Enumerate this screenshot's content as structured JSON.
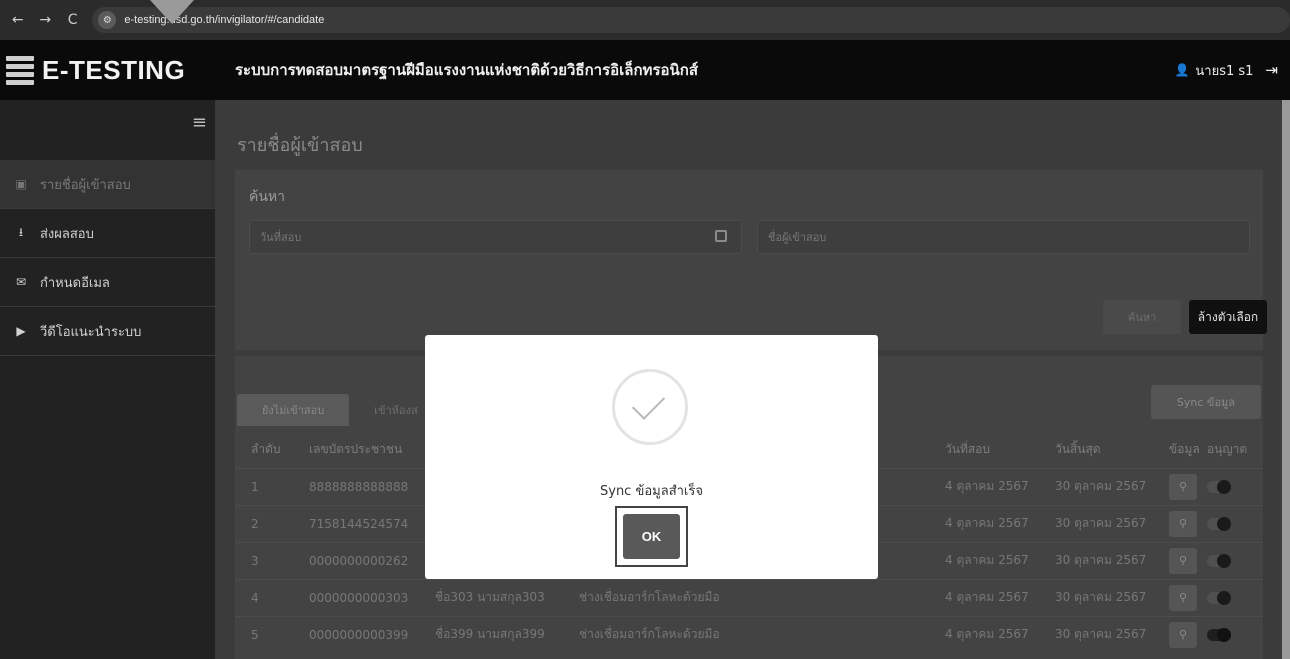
{
  "browser": {
    "back": "←",
    "forward": "→",
    "reload": "C",
    "url": "e-testing.dsd.go.th/invigilator/#/candidate"
  },
  "header": {
    "brand": "E-TESTING",
    "title": "ระบบการทดสอบมาตรฐานฝีมือแรงงานแห่งชาติด้วยวิธีการอิเล็กทรอนิกส์",
    "user": "นายs1 s1",
    "user_icon": "user-icon",
    "logout_icon": "logout-icon"
  },
  "sidebar": {
    "items": [
      {
        "label": "รายชื่อผู้เข้าสอบ",
        "icon": "contact-card-icon"
      },
      {
        "label": "ส่งผลสอบ",
        "icon": "upload-icon"
      },
      {
        "label": "กำหนดอีเมล",
        "icon": "mail-icon"
      },
      {
        "label": "วีดีโอแนะนำระบบ",
        "icon": "play-icon"
      }
    ]
  },
  "main": {
    "page_title": "รายชื่อผู้เข้าสอบ",
    "search": {
      "heading": "ค้นหา",
      "date_placeholder": "วันที่สอบ",
      "name_placeholder": "ชื่อผู้เข้าสอบ",
      "search_button": "ค้นหา",
      "clear_button": "ล้างตัวเลือก"
    },
    "tabs": [
      {
        "label": "ยังไม่เข้าสอบ"
      },
      {
        "label": "เข้าห้องส"
      }
    ],
    "sync_button": "Sync ข้อมูล",
    "table": {
      "headers": [
        "ลำดับ",
        "เลขบัตรประชาชน",
        "",
        "",
        "วันที่สอบ",
        "วันสิ้นสุด",
        "ข้อมูล",
        "อนุญาต"
      ],
      "rows": [
        {
          "no": "1",
          "id": "8888888888888",
          "name": "",
          "skill": "",
          "exam_date": "4 ตุลาคม 2567",
          "end_date": "30 ตุลาคม 2567",
          "allowed": false
        },
        {
          "no": "2",
          "id": "7158144524574",
          "name": "",
          "skill": "",
          "exam_date": "4 ตุลาคม 2567",
          "end_date": "30 ตุลาคม 2567",
          "allowed": false
        },
        {
          "no": "3",
          "id": "0000000000262",
          "name": "",
          "skill": "",
          "exam_date": "4 ตุลาคม 2567",
          "end_date": "30 ตุลาคม 2567",
          "allowed": false
        },
        {
          "no": "4",
          "id": "0000000000303",
          "name": "ชื่อ303 นามสกุล303",
          "skill": "ช่างเชื่อมอาร์กโลหะด้วยมือ",
          "exam_date": "4 ตุลาคม 2567",
          "end_date": "30 ตุลาคม 2567",
          "allowed": false
        },
        {
          "no": "5",
          "id": "0000000000399",
          "name": "ชื่อ399 นามสกุล399",
          "skill": "ช่างเชื่อมอาร์กโลหะด้วยมือ",
          "exam_date": "4 ตุลาคม 2567",
          "end_date": "30 ตุลาคม 2567",
          "allowed": true
        }
      ]
    }
  },
  "modal": {
    "message": "Sync ข้อมูลสำเร็จ",
    "ok_button": "OK",
    "icon": "success-check-icon"
  }
}
